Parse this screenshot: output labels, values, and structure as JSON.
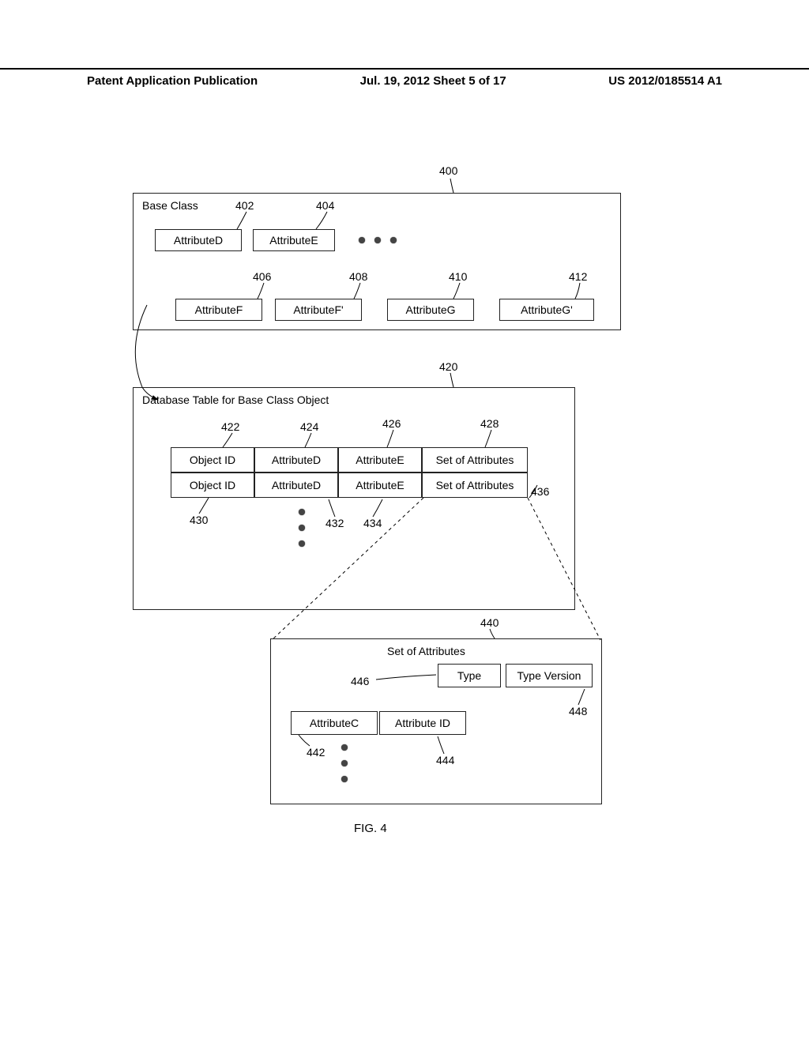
{
  "header": {
    "left": "Patent Application Publication",
    "center": "Jul. 19, 2012  Sheet 5 of 17",
    "right": "US 2012/0185514 A1"
  },
  "base_class": {
    "title": "Base Class",
    "ref": "400",
    "row1": [
      {
        "label": "AttributeD",
        "ref": "402"
      },
      {
        "label": "AttributeE",
        "ref": "404"
      }
    ],
    "row2": [
      {
        "label": "AttributeF",
        "ref": "406"
      },
      {
        "label": "AttributeF'",
        "ref": "408"
      },
      {
        "label": "AttributeG",
        "ref": "410"
      },
      {
        "label": "AttributeG'",
        "ref": "412"
      }
    ]
  },
  "db_table": {
    "title": "Database Table for Base Class Object",
    "ref": "420",
    "headers": [
      {
        "label": "Object ID",
        "ref": "422"
      },
      {
        "label": "AttributeD",
        "ref": "424"
      },
      {
        "label": "AttributeE",
        "ref": "426"
      },
      {
        "label": "Set of Attributes",
        "ref": "428"
      }
    ],
    "row2": [
      {
        "label": "Object ID",
        "ref": "430"
      },
      {
        "label": "AttributeD",
        "ref": "432"
      },
      {
        "label": "AttributeE",
        "ref": "434"
      },
      {
        "label": "Set of Attributes",
        "ref": "436"
      }
    ]
  },
  "set_attrs": {
    "title": "Set of Attributes",
    "ref": "440",
    "type_box": {
      "label": "Type",
      "ref": "446"
    },
    "type_version_box": {
      "label": "Type Version",
      "ref": "448"
    },
    "attr_c": {
      "label": "AttributeC",
      "ref": "442"
    },
    "attr_id": {
      "label": "Attribute ID",
      "ref": "444"
    }
  },
  "figure_caption": "FIG. 4"
}
